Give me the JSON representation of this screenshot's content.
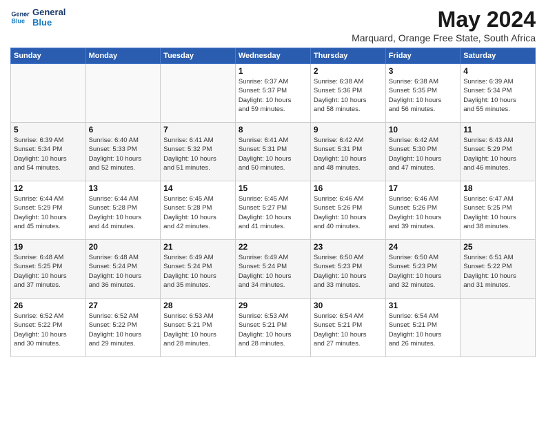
{
  "header": {
    "logo_line1": "General",
    "logo_line2": "Blue",
    "month": "May 2024",
    "location": "Marquard, Orange Free State, South Africa"
  },
  "weekdays": [
    "Sunday",
    "Monday",
    "Tuesday",
    "Wednesday",
    "Thursday",
    "Friday",
    "Saturday"
  ],
  "weeks": [
    [
      {
        "day": "",
        "info": ""
      },
      {
        "day": "",
        "info": ""
      },
      {
        "day": "",
        "info": ""
      },
      {
        "day": "1",
        "info": "Sunrise: 6:37 AM\nSunset: 5:37 PM\nDaylight: 10 hours\nand 59 minutes."
      },
      {
        "day": "2",
        "info": "Sunrise: 6:38 AM\nSunset: 5:36 PM\nDaylight: 10 hours\nand 58 minutes."
      },
      {
        "day": "3",
        "info": "Sunrise: 6:38 AM\nSunset: 5:35 PM\nDaylight: 10 hours\nand 56 minutes."
      },
      {
        "day": "4",
        "info": "Sunrise: 6:39 AM\nSunset: 5:34 PM\nDaylight: 10 hours\nand 55 minutes."
      }
    ],
    [
      {
        "day": "5",
        "info": "Sunrise: 6:39 AM\nSunset: 5:34 PM\nDaylight: 10 hours\nand 54 minutes."
      },
      {
        "day": "6",
        "info": "Sunrise: 6:40 AM\nSunset: 5:33 PM\nDaylight: 10 hours\nand 52 minutes."
      },
      {
        "day": "7",
        "info": "Sunrise: 6:41 AM\nSunset: 5:32 PM\nDaylight: 10 hours\nand 51 minutes."
      },
      {
        "day": "8",
        "info": "Sunrise: 6:41 AM\nSunset: 5:31 PM\nDaylight: 10 hours\nand 50 minutes."
      },
      {
        "day": "9",
        "info": "Sunrise: 6:42 AM\nSunset: 5:31 PM\nDaylight: 10 hours\nand 48 minutes."
      },
      {
        "day": "10",
        "info": "Sunrise: 6:42 AM\nSunset: 5:30 PM\nDaylight: 10 hours\nand 47 minutes."
      },
      {
        "day": "11",
        "info": "Sunrise: 6:43 AM\nSunset: 5:29 PM\nDaylight: 10 hours\nand 46 minutes."
      }
    ],
    [
      {
        "day": "12",
        "info": "Sunrise: 6:44 AM\nSunset: 5:29 PM\nDaylight: 10 hours\nand 45 minutes."
      },
      {
        "day": "13",
        "info": "Sunrise: 6:44 AM\nSunset: 5:28 PM\nDaylight: 10 hours\nand 44 minutes."
      },
      {
        "day": "14",
        "info": "Sunrise: 6:45 AM\nSunset: 5:28 PM\nDaylight: 10 hours\nand 42 minutes."
      },
      {
        "day": "15",
        "info": "Sunrise: 6:45 AM\nSunset: 5:27 PM\nDaylight: 10 hours\nand 41 minutes."
      },
      {
        "day": "16",
        "info": "Sunrise: 6:46 AM\nSunset: 5:26 PM\nDaylight: 10 hours\nand 40 minutes."
      },
      {
        "day": "17",
        "info": "Sunrise: 6:46 AM\nSunset: 5:26 PM\nDaylight: 10 hours\nand 39 minutes."
      },
      {
        "day": "18",
        "info": "Sunrise: 6:47 AM\nSunset: 5:25 PM\nDaylight: 10 hours\nand 38 minutes."
      }
    ],
    [
      {
        "day": "19",
        "info": "Sunrise: 6:48 AM\nSunset: 5:25 PM\nDaylight: 10 hours\nand 37 minutes."
      },
      {
        "day": "20",
        "info": "Sunrise: 6:48 AM\nSunset: 5:24 PM\nDaylight: 10 hours\nand 36 minutes."
      },
      {
        "day": "21",
        "info": "Sunrise: 6:49 AM\nSunset: 5:24 PM\nDaylight: 10 hours\nand 35 minutes."
      },
      {
        "day": "22",
        "info": "Sunrise: 6:49 AM\nSunset: 5:24 PM\nDaylight: 10 hours\nand 34 minutes."
      },
      {
        "day": "23",
        "info": "Sunrise: 6:50 AM\nSunset: 5:23 PM\nDaylight: 10 hours\nand 33 minutes."
      },
      {
        "day": "24",
        "info": "Sunrise: 6:50 AM\nSunset: 5:23 PM\nDaylight: 10 hours\nand 32 minutes."
      },
      {
        "day": "25",
        "info": "Sunrise: 6:51 AM\nSunset: 5:22 PM\nDaylight: 10 hours\nand 31 minutes."
      }
    ],
    [
      {
        "day": "26",
        "info": "Sunrise: 6:52 AM\nSunset: 5:22 PM\nDaylight: 10 hours\nand 30 minutes."
      },
      {
        "day": "27",
        "info": "Sunrise: 6:52 AM\nSunset: 5:22 PM\nDaylight: 10 hours\nand 29 minutes."
      },
      {
        "day": "28",
        "info": "Sunrise: 6:53 AM\nSunset: 5:21 PM\nDaylight: 10 hours\nand 28 minutes."
      },
      {
        "day": "29",
        "info": "Sunrise: 6:53 AM\nSunset: 5:21 PM\nDaylight: 10 hours\nand 28 minutes."
      },
      {
        "day": "30",
        "info": "Sunrise: 6:54 AM\nSunset: 5:21 PM\nDaylight: 10 hours\nand 27 minutes."
      },
      {
        "day": "31",
        "info": "Sunrise: 6:54 AM\nSunset: 5:21 PM\nDaylight: 10 hours\nand 26 minutes."
      },
      {
        "day": "",
        "info": ""
      }
    ]
  ]
}
